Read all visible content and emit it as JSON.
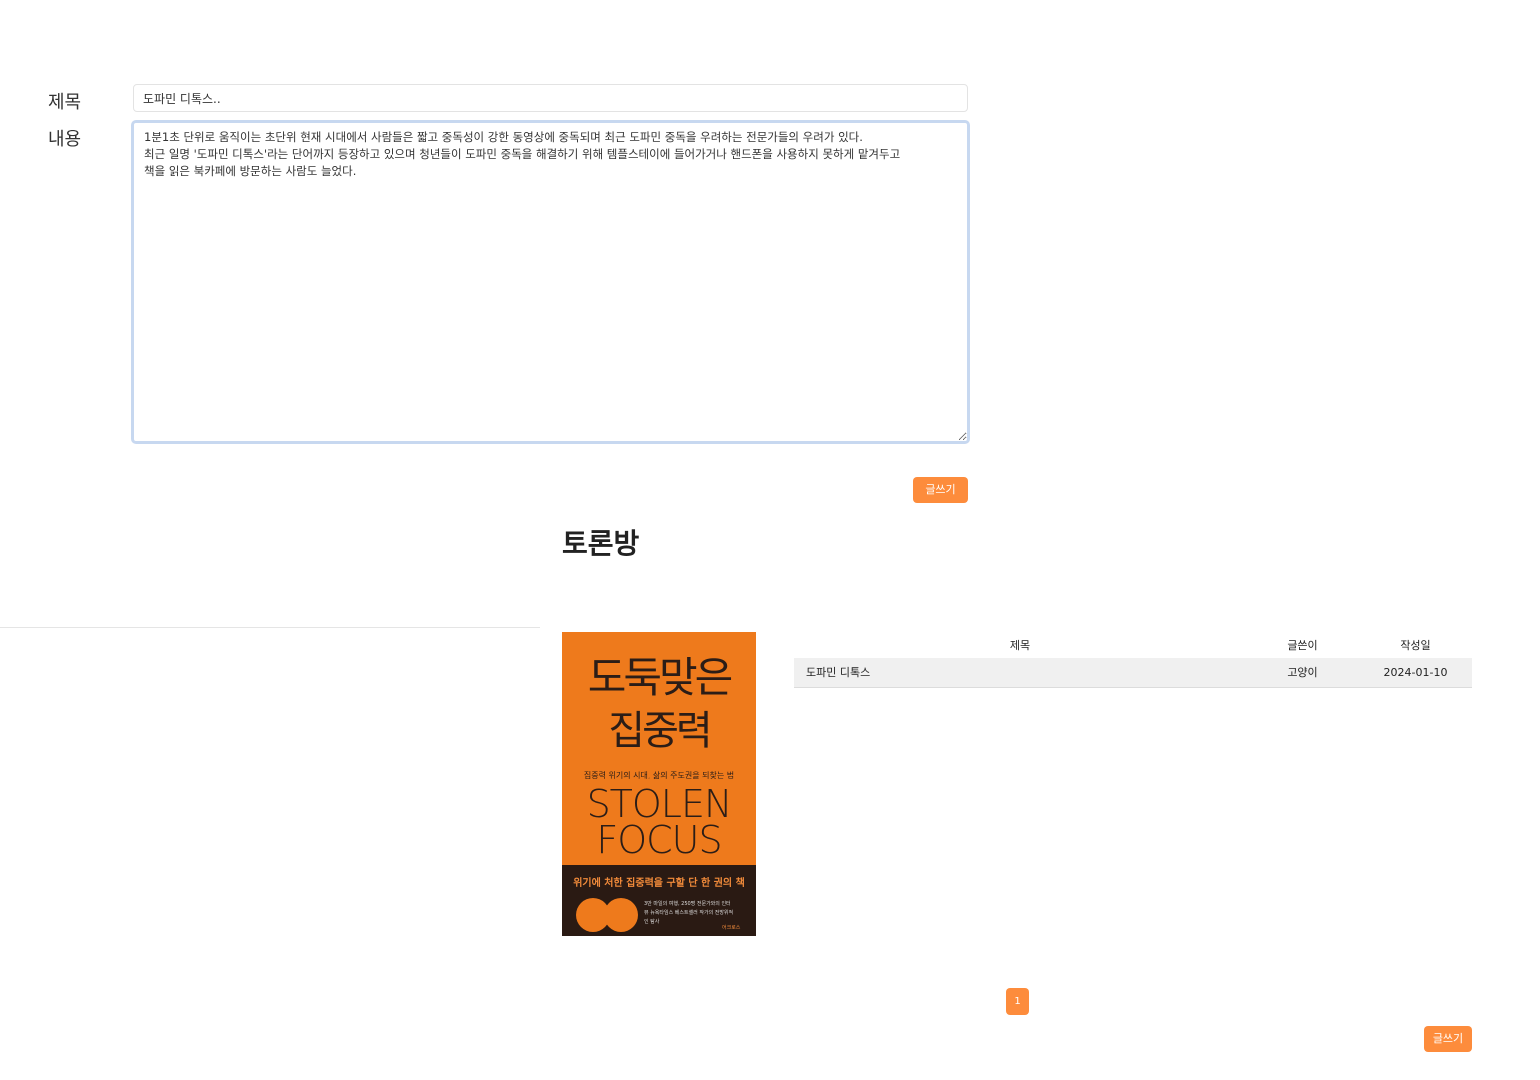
{
  "form": {
    "title_label": "제목",
    "content_label": "내용",
    "title_value": "도파민 디톡스..",
    "content_value": "1분1초 단위로 움직이는 초단위 현재 시대에서 사람들은 짧고 중독성이 강한 동영상에 중독되며 최근 도파민 중독을 우려하는 전문가들의 우려가 있다.\n최근 일명 '도파민 디톡스'라는 단어까지 등장하고 있으며 청년들이 도파민 중독을 해결하기 위해 템플스테이에 들어가거나 핸드폰을 사용하지 못하게 맡겨두고\n책을 읽은 북카페에 방문하는 사람도 늘었다.",
    "submit_label": "글쓰기"
  },
  "board": {
    "heading": "토론방",
    "columns": {
      "title": "제목",
      "author": "글쓴이",
      "date": "작성일"
    },
    "rows": [
      {
        "title": "도파민 디톡스",
        "author": "고양이",
        "date": "2024-01-10"
      }
    ],
    "pagination": {
      "current_page": "1"
    },
    "write_label": "글쓰기"
  },
  "book_cover": {
    "title_line1": "도둑맞은",
    "title_line2": "집중력",
    "subtitle": "집중력 위기의 시대, 삶의 주도권을 되찾는 법",
    "english_line1": "STOLEN",
    "english_line2": "FOCUS",
    "tagline": "위기에 처한 집중력을 구할 단 한 권의 책",
    "blurb": "3만 마일의 여행, 250명 전문가와의 인터뷰 뉴욕타임스 베스트셀러 작가의 전방위적인 탐사",
    "publisher": "어크로스"
  },
  "colors": {
    "accent": "#fd8c3c",
    "cover_orange": "#ee7a1c",
    "cover_dark": "#2a1a13",
    "row_bg": "#f0f0f0"
  }
}
